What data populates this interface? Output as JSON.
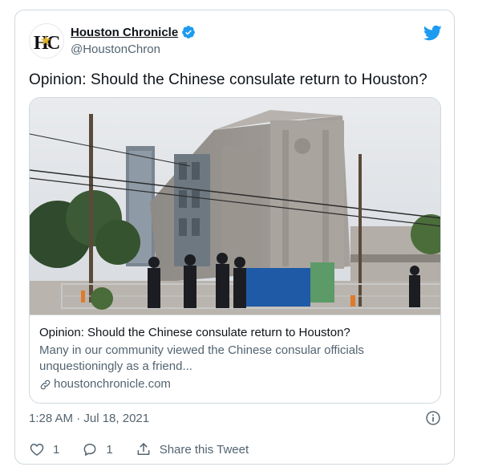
{
  "account": {
    "display_name": "Houston Chronicle",
    "handle": "@HoustonChron",
    "avatar_logo": "HC"
  },
  "tweet": {
    "text": "Opinion: Should the Chinese consulate return to Houston?",
    "timestamp": "1:28 AM · Jul 18, 2021"
  },
  "card": {
    "title": "Opinion: Should the Chinese consulate return to Houston?",
    "description_line1": "Many in our community viewed the Chinese consular officials",
    "description_line2": "unquestioningly as a friend...",
    "domain": "houstonchronicle.com"
  },
  "actions": {
    "like_count": "1",
    "reply_count": "1",
    "share_label": "Share this Tweet"
  },
  "colors": {
    "twitter_blue": "#1d9bf0",
    "secondary_text": "#536471",
    "border": "#cfd9de"
  }
}
